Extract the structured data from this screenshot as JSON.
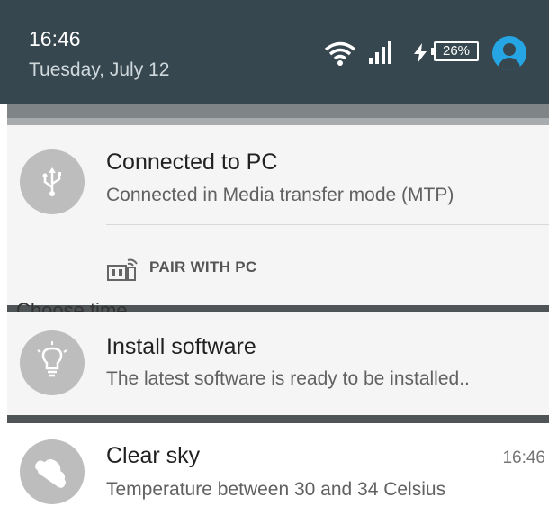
{
  "status_bar": {
    "time": "16:46",
    "date": "Tuesday, July 12",
    "battery_level": "26%",
    "icons": [
      "wifi-icon",
      "cell-signal-icon",
      "charging-bolt-icon",
      "battery-icon",
      "account-icon"
    ]
  },
  "hidden_text": "Choose time",
  "notifications": [
    {
      "icon": "usb-icon",
      "title": "Connected to PC",
      "subtitle": "Connected in Media transfer mode (MTP)",
      "action": {
        "icon": "pc-wireless-icon",
        "label": "PAIR WITH PC"
      }
    },
    {
      "icon": "lightbulb-icon",
      "title": "Install software",
      "subtitle": "The latest software is ready to be installed.."
    },
    {
      "icon": "weather-cloud-icon",
      "title": "Clear sky",
      "time": "16:46",
      "subtitle": "Temperature between 30 and 34 Celsius"
    }
  ],
  "colors": {
    "status_bar_bg": "#37474f",
    "accent": "#26a5e4",
    "icon_circle": "#bdbdbd"
  }
}
